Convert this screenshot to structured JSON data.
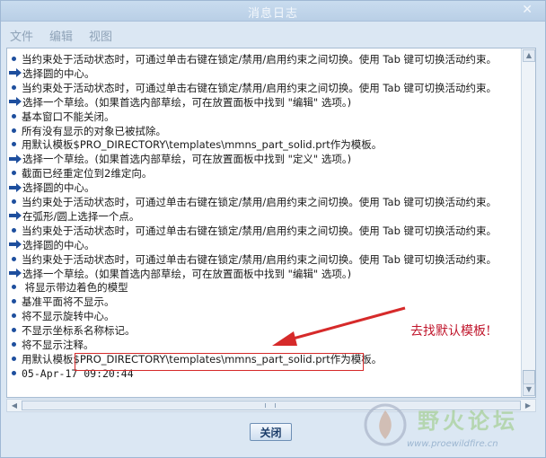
{
  "window": {
    "title": "消息日志"
  },
  "menu": [
    {
      "label": "文件"
    },
    {
      "label": "编辑"
    },
    {
      "label": "视图"
    }
  ],
  "log": [
    {
      "icon": "bullet-icon",
      "text": "当约束处于活动状态时，可通过单击右键在锁定/禁用/启用约束之间切换。使用 Tab 键可切换活动约束。"
    },
    {
      "icon": "arrow-right-icon",
      "text": "选择圆的中心。"
    },
    {
      "icon": "bullet-icon",
      "text": "当约束处于活动状态时，可通过单击右键在锁定/禁用/启用约束之间切换。使用 Tab 键可切换活动约束。"
    },
    {
      "icon": "arrow-right-icon",
      "text": "选择一个草绘。(如果首选内部草绘，可在放置面板中找到 \"编辑\" 选项。)"
    },
    {
      "icon": "bullet-icon",
      "text": "基本窗口不能关闭。"
    },
    {
      "icon": "bullet-icon",
      "text": "所有没有显示的对象已被拭除。"
    },
    {
      "icon": "bullet-icon",
      "text": "用默认模板$PRO_DIRECTORY\\templates\\mmns_part_solid.prt作为模板。"
    },
    {
      "icon": "arrow-right-icon",
      "text": "选择一个草绘。(如果首选内部草绘，可在放置面板中找到 \"定义\" 选项。)"
    },
    {
      "icon": "bullet-icon",
      "text": "截面已经重定位到2维定向。"
    },
    {
      "icon": "arrow-right-icon",
      "text": "选择圆的中心。"
    },
    {
      "icon": "bullet-icon",
      "text": "当约束处于活动状态时，可通过单击右键在锁定/禁用/启用约束之间切换。使用 Tab 键可切换活动约束。"
    },
    {
      "icon": "arrow-right-icon",
      "text": "在弧形/圆上选择一个点。"
    },
    {
      "icon": "bullet-icon",
      "text": "当约束处于活动状态时，可通过单击右键在锁定/禁用/启用约束之间切换。使用 Tab 键可切换活动约束。"
    },
    {
      "icon": "arrow-right-icon",
      "text": "选择圆的中心。"
    },
    {
      "icon": "bullet-icon",
      "text": "当约束处于活动状态时，可通过单击右键在锁定/禁用/启用约束之间切换。使用 Tab 键可切换活动约束。"
    },
    {
      "icon": "arrow-right-icon",
      "text": "选择一个草绘。(如果首选内部草绘，可在放置面板中找到 \"编辑\" 选项。)"
    },
    {
      "icon": "bullet-icon",
      "text": " 将显示带边着色的模型"
    },
    {
      "icon": "bullet-icon",
      "text": "基准平面将不显示。"
    },
    {
      "icon": "bullet-icon",
      "text": "将不显示旋转中心。"
    },
    {
      "icon": "bullet-icon",
      "text": "不显示坐标系名称标记。"
    },
    {
      "icon": "bullet-icon",
      "text": "将不显示注释。"
    },
    {
      "icon": "bullet-icon",
      "text": "用默认模板$PRO_DIRECTORY\\templates\\mmns_part_solid.prt作为模板。"
    },
    {
      "icon": "bullet-icon",
      "text": "05-Apr-17 09:20:44"
    }
  ],
  "buttons": {
    "close": "关闭"
  },
  "annotation": {
    "text": "去找默认模板!"
  },
  "watermark": {
    "name": "野火论坛",
    "url": "www.proewildfire.cn"
  },
  "colors": {
    "accent": "#1e4f9e",
    "annotation": "#c0162c"
  }
}
